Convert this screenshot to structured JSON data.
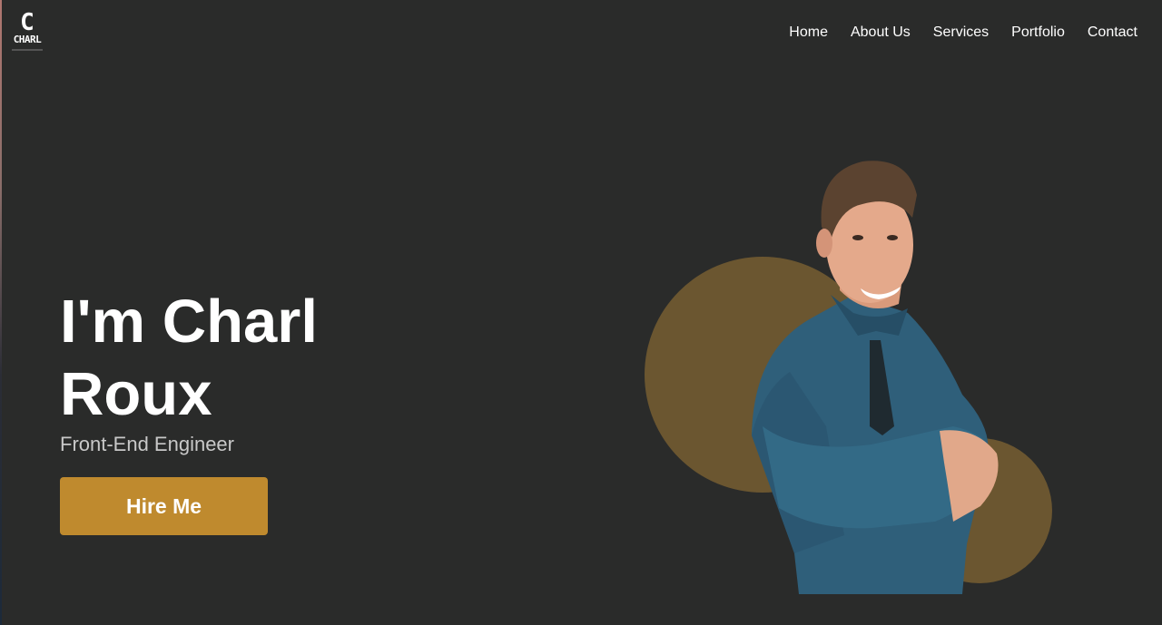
{
  "logo": {
    "glyph": "C",
    "word": "CHARL"
  },
  "nav": {
    "items": [
      "Home",
      "About Us",
      "Services",
      "Portfolio",
      "Contact"
    ]
  },
  "hero": {
    "title_line1": "I'm Charl",
    "title_line2": "Roux",
    "subtitle": "Front-End Engineer",
    "cta_label": "Hire Me"
  },
  "colors": {
    "background": "#2a2b2a",
    "accent": "#bf8a2e",
    "circle": "#6b5630",
    "shirt": "#2f5f7a"
  }
}
